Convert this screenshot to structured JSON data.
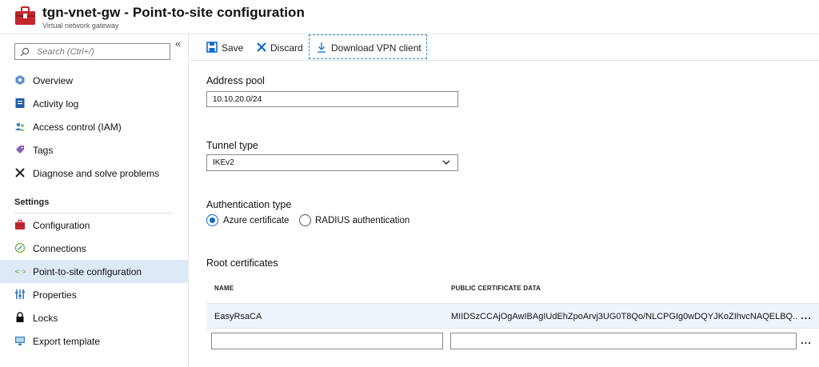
{
  "header": {
    "title": "tgn-vnet-gw - Point-to-site configuration",
    "subtitle": "Virtual network gateway"
  },
  "sidebar": {
    "collapse_glyph": "«",
    "search": {
      "placeholder": "Search (Ctrl+/)"
    },
    "items": [
      {
        "label": "Overview",
        "icon": "overview-icon"
      },
      {
        "label": "Activity log",
        "icon": "activity-log-icon"
      },
      {
        "label": "Access control (IAM)",
        "icon": "iam-icon"
      },
      {
        "label": "Tags",
        "icon": "tag-icon"
      },
      {
        "label": "Diagnose and solve problems",
        "icon": "wrench-icon"
      }
    ],
    "settings_label": "Settings",
    "settings_items": [
      {
        "label": "Configuration",
        "icon": "configuration-icon"
      },
      {
        "label": "Connections",
        "icon": "connections-icon"
      },
      {
        "label": "Point-to-site configuration",
        "icon": "point-to-site-icon",
        "active": true
      },
      {
        "label": "Properties",
        "icon": "properties-icon"
      },
      {
        "label": "Locks",
        "icon": "lock-icon"
      },
      {
        "label": "Export template",
        "icon": "export-template-icon"
      }
    ]
  },
  "toolbar": {
    "save_label": "Save",
    "discard_label": "Discard",
    "download_label": "Download VPN client"
  },
  "form": {
    "address_pool_label": "Address pool",
    "address_pool_value": "10.10.20.0/24",
    "tunnel_type_label": "Tunnel type",
    "tunnel_type_value": "IKEv2",
    "auth_type_label": "Authentication type",
    "auth_options": [
      {
        "label": "Azure certificate",
        "checked": true
      },
      {
        "label": "RADIUS authentication",
        "checked": false
      }
    ],
    "root_certs_label": "Root certificates",
    "columns": [
      "NAME",
      "PUBLIC CERTIFICATE DATA"
    ],
    "rows": [
      {
        "name": "EasyRsaCA",
        "data": "MIIDSzCCAjOgAwIBAgIUdEhZpoArvj3UG0T8Qo/NLCPGIg0wDQYJKoZIhvcNAQELBQ...",
        "more": "..."
      }
    ],
    "new_row_more": "..."
  },
  "colors": {
    "accent": "#0b6cd0",
    "active_bg": "#dde9f6",
    "resource_red": "#c4262e"
  }
}
